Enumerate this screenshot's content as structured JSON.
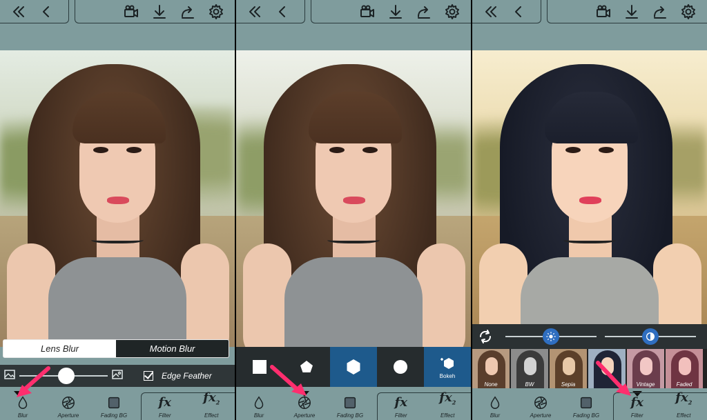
{
  "top_icons": [
    "double-chevron-left-icon",
    "chevron-left-icon",
    "video-camera-icon",
    "download-icon",
    "share-icon",
    "gear-icon"
  ],
  "panel1": {
    "segmented": {
      "lens": "Lens Blur",
      "motion": "Motion Blur"
    },
    "edge_feather": "Edge Feather",
    "slider_value": 0.45
  },
  "panel2": {
    "bokeh_label": "Bokeh"
  },
  "panel3": {
    "filters": [
      {
        "name": "None"
      },
      {
        "name": "BW"
      },
      {
        "name": "Sepia"
      },
      {
        "name": ""
      },
      {
        "name": "Vintage"
      },
      {
        "name": "Faded"
      }
    ]
  },
  "bottom_tabs": {
    "blur": "Blur",
    "aperture": "Aperture",
    "fading": "Fading BG",
    "filter": "Filter",
    "effect": "Effect"
  },
  "colors": {
    "toolbar": "#7f9c9d",
    "accent_blue": "#1e5a8c",
    "arrow": "#ff2e6e"
  }
}
